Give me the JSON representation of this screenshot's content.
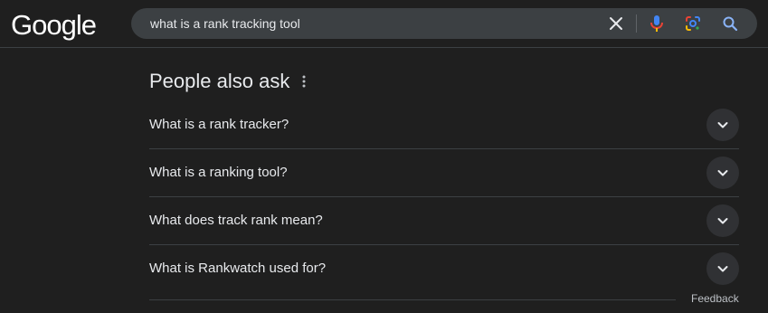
{
  "header": {
    "logo_text": "Google",
    "search": {
      "query": "what is a rank tracking tool"
    },
    "icons": {
      "clear": "close-icon",
      "voice": "mic-icon",
      "lens": "google-lens-icon",
      "search": "search-icon"
    }
  },
  "people_also_ask": {
    "title": "People also ask",
    "menu_icon": "more-vert-icon",
    "questions": [
      {
        "text": "What is a rank tracker?"
      },
      {
        "text": "What is a ranking tool?"
      },
      {
        "text": "What does track rank mean?"
      },
      {
        "text": "What is Rankwatch used for?"
      }
    ]
  },
  "footer": {
    "feedback_label": "Feedback"
  },
  "colors": {
    "background": "#1f1f1f",
    "searchbox": "#3c4043",
    "text": "#e8eaed",
    "muted_text": "#bdc1c6",
    "divider": "#3c4043",
    "mic_blue": "#4285f4",
    "mic_red": "#ea4335",
    "search_icon": "#8ab4f8"
  }
}
